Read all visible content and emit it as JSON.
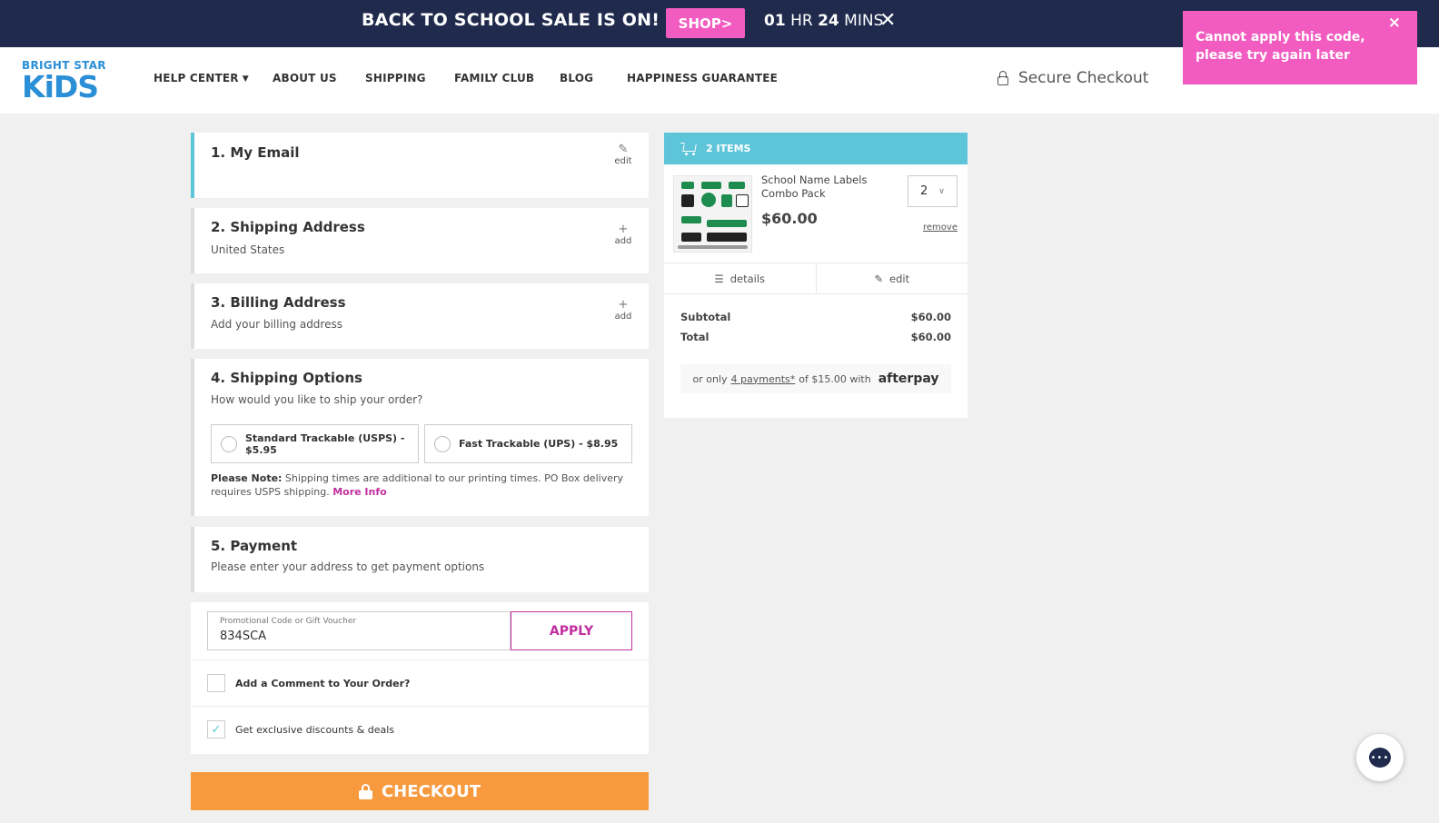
{
  "promo_bar": {
    "title": "BACK TO SCHOOL SALE IS ON!",
    "shop_label": "SHOP>",
    "timer_hours": "01",
    "timer_hr_label": "HR",
    "timer_mins": "24",
    "timer_mins_label": "MINS",
    "close_symbol": "✕"
  },
  "header": {
    "logo_top": "BRIGHT STAR",
    "logo_kids": "KiDS",
    "nav": [
      "HELP CENTER",
      "ABOUT US",
      "SHIPPING",
      "FAMILY CLUB",
      "BLOG",
      "HAPPINESS GUARANTEE"
    ],
    "secure_checkout": "Secure Checkout"
  },
  "toast": {
    "message": "Cannot apply this code, please try again later",
    "close_symbol": "×",
    "color": "#f25cc0"
  },
  "steps": {
    "email": {
      "title": "1. My Email",
      "action": "edit"
    },
    "shipping_address": {
      "title": "2. Shipping Address",
      "subtitle": "United States",
      "action": "add"
    },
    "billing_address": {
      "title": "3. Billing Address",
      "subtitle": "Add your billing address",
      "action": "add"
    },
    "shipping_options": {
      "title": "4. Shipping Options",
      "subtitle": "How would you like to ship your order?",
      "options": [
        "Standard Trackable (USPS) - $5.95",
        "Fast Trackable (UPS) - $8.95"
      ],
      "note_label": "Please Note:",
      "note_text": " Shipping times are additional to our printing times. PO Box delivery requires USPS shipping. ",
      "more_info": "More Info"
    },
    "payment": {
      "title": "5. Payment",
      "subtitle": "Please enter your address to get payment options"
    }
  },
  "promo_code": {
    "label": "Promotional Code or Gift Voucher",
    "value": "834SCA",
    "apply": "APPLY"
  },
  "options": {
    "comment": "Add a Comment to Your Order?",
    "deals": "Get exclusive discounts & deals",
    "deals_checked": true
  },
  "checkout_label": "CHECKOUT",
  "cart": {
    "header": "2 ITEMS",
    "item_name": "School Name Labels Combo Pack",
    "item_price": "$60.00",
    "quantity": "2",
    "remove": "remove",
    "details": "details",
    "edit": "edit",
    "subtotal_label": "Subtotal",
    "subtotal_value": "$60.00",
    "total_label": "Total",
    "total_value": "$60.00",
    "afterpay_prefix": "or only",
    "afterpay_link": "4 payments*",
    "afterpay_mid": "of $15.00 with",
    "afterpay_brand": "afterpay"
  },
  "colors": {
    "banner": "#1f2a4d",
    "accent_pink": "#f25cc0",
    "accent_teal": "#5ec4d8",
    "checkout_orange": "#f79a3e"
  }
}
